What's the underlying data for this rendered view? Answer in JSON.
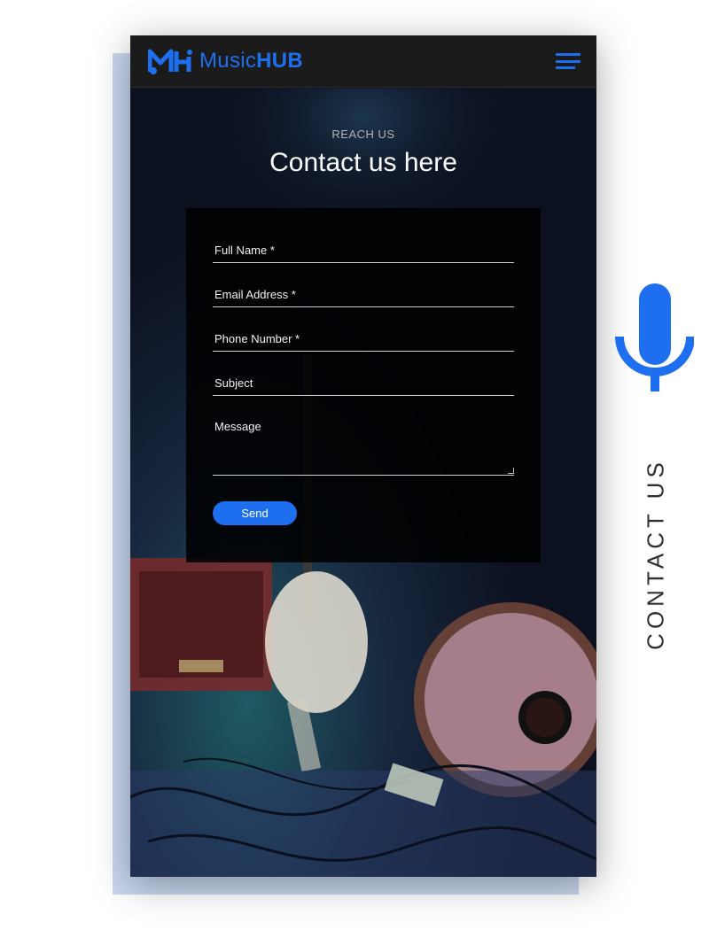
{
  "navbar": {
    "logo_text_light": "Music",
    "logo_text_bold": "HUB",
    "logo_icon": "mh-logo-icon",
    "menu_icon": "hamburger-menu-icon"
  },
  "hero": {
    "eyebrow": "REACH US",
    "title": "Contact us here"
  },
  "form": {
    "fields": [
      {
        "placeholder": "Full Name *",
        "value": ""
      },
      {
        "placeholder": "Email Address *",
        "value": ""
      },
      {
        "placeholder": "Phone Number *",
        "value": ""
      },
      {
        "placeholder": "Subject",
        "value": ""
      },
      {
        "placeholder": "Message",
        "value": ""
      }
    ],
    "send_label": "Send"
  },
  "side": {
    "label": "CONTACT US",
    "icon": "microphone-icon"
  },
  "colors": {
    "accent": "#1e6ff0",
    "navbar_bg": "#1b1b1b",
    "form_bg": "#000000",
    "backdrop": "#c9d7ef"
  }
}
